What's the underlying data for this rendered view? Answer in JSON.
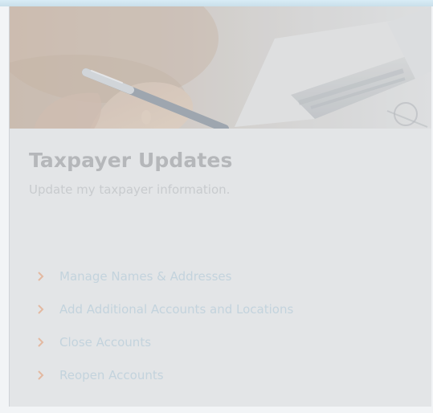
{
  "card": {
    "title": "Taxpayer Updates",
    "subtitle": "Update my taxpayer information."
  },
  "hero": {
    "icon": "hero-photo-hand-pen-laptop"
  },
  "links": [
    {
      "label": "Manage Names & Addresses",
      "icon": "chevron-right-icon"
    },
    {
      "label": "Add Additional Accounts and Locations",
      "icon": "chevron-right-icon"
    },
    {
      "label": "Close Accounts",
      "icon": "chevron-right-icon"
    },
    {
      "label": "Reopen Accounts",
      "icon": "chevron-right-icon"
    }
  ],
  "colors": {
    "chevron": "#e3b9a1",
    "link_text": "#c3d3dd",
    "title": "#b5b7ba",
    "subtitle": "#c8cbce",
    "card_bg": "#e3e5e7",
    "top_accent": "#d8ecf6"
  }
}
